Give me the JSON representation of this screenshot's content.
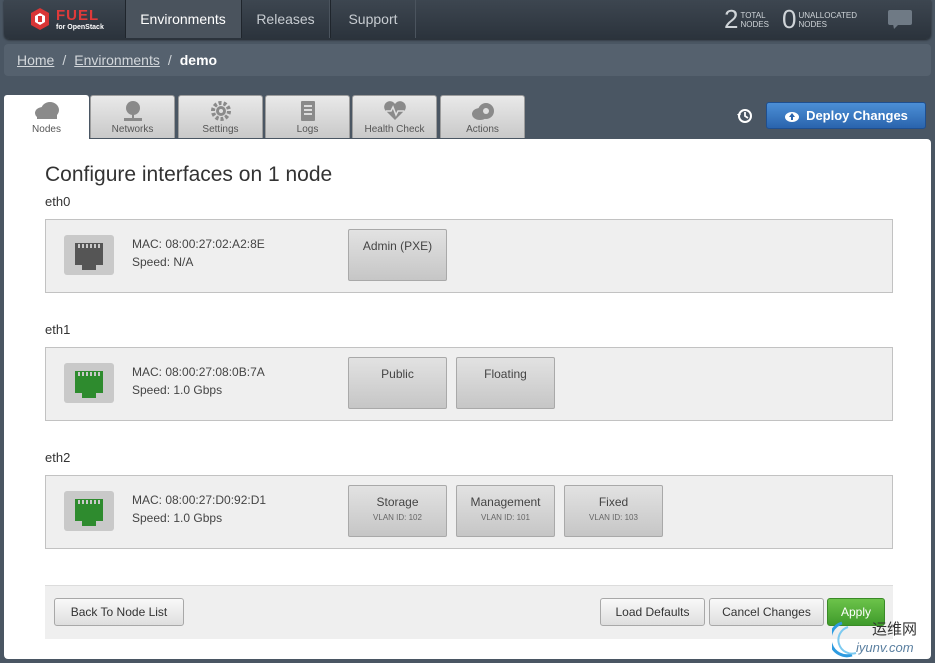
{
  "header": {
    "logo_text": "FUEL",
    "logo_subtext": "for OpenStack",
    "nav": [
      {
        "label": "Environments",
        "active": true
      },
      {
        "label": "Releases",
        "active": false
      },
      {
        "label": "Support",
        "active": false
      }
    ],
    "counters": [
      {
        "value": "2",
        "label_line1": "TOTAL",
        "label_line2": "NODES"
      },
      {
        "value": "0",
        "label_line1": "UNALLOCATED",
        "label_line2": "NODES"
      }
    ],
    "notification_icon": "chat-bubble-icon"
  },
  "breadcrumb": {
    "items": [
      "Home",
      "Environments"
    ],
    "separator": "/",
    "current": "demo"
  },
  "tabs": [
    {
      "label": "Nodes",
      "icon": "nodes-icon",
      "active": true
    },
    {
      "label": "Networks",
      "icon": "networks-icon",
      "active": false
    },
    {
      "label": "Settings",
      "icon": "gear-icon",
      "active": false
    },
    {
      "label": "Logs",
      "icon": "logs-icon",
      "active": false
    },
    {
      "label": "Health Check",
      "icon": "heart-icon",
      "active": false
    },
    {
      "label": "Actions",
      "icon": "actions-icon",
      "active": false
    }
  ],
  "toolbar": {
    "history_icon": "history-icon",
    "deploy_label": "Deploy Changes"
  },
  "page": {
    "title": "Configure interfaces on 1 node"
  },
  "interfaces": [
    {
      "name": "eth0",
      "mac": "MAC: 08:00:27:02:A2:8E",
      "speed": "Speed: N/A",
      "status_color": "#555555",
      "networks": [
        {
          "name": "Admin (PXE)",
          "vlan": ""
        }
      ]
    },
    {
      "name": "eth1",
      "mac": "MAC: 08:00:27:08:0B:7A",
      "speed": "Speed: 1.0 Gbps",
      "status_color": "#2e8b2e",
      "networks": [
        {
          "name": "Public",
          "vlan": ""
        },
        {
          "name": "Floating",
          "vlan": ""
        }
      ]
    },
    {
      "name": "eth2",
      "mac": "MAC: 08:00:27:D0:92:D1",
      "speed": "Speed: 1.0 Gbps",
      "status_color": "#2e8b2e",
      "networks": [
        {
          "name": "Storage",
          "vlan": "VLAN ID: 102"
        },
        {
          "name": "Management",
          "vlan": "VLAN ID: 101"
        },
        {
          "name": "Fixed",
          "vlan": "VLAN ID: 103"
        }
      ]
    }
  ],
  "footer": {
    "back_label": "Back To Node List",
    "load_defaults_label": "Load Defaults",
    "cancel_label": "Cancel Changes",
    "apply_label": "Apply"
  },
  "watermark": {
    "cn": "运维网",
    "en": "iyunv.com"
  }
}
